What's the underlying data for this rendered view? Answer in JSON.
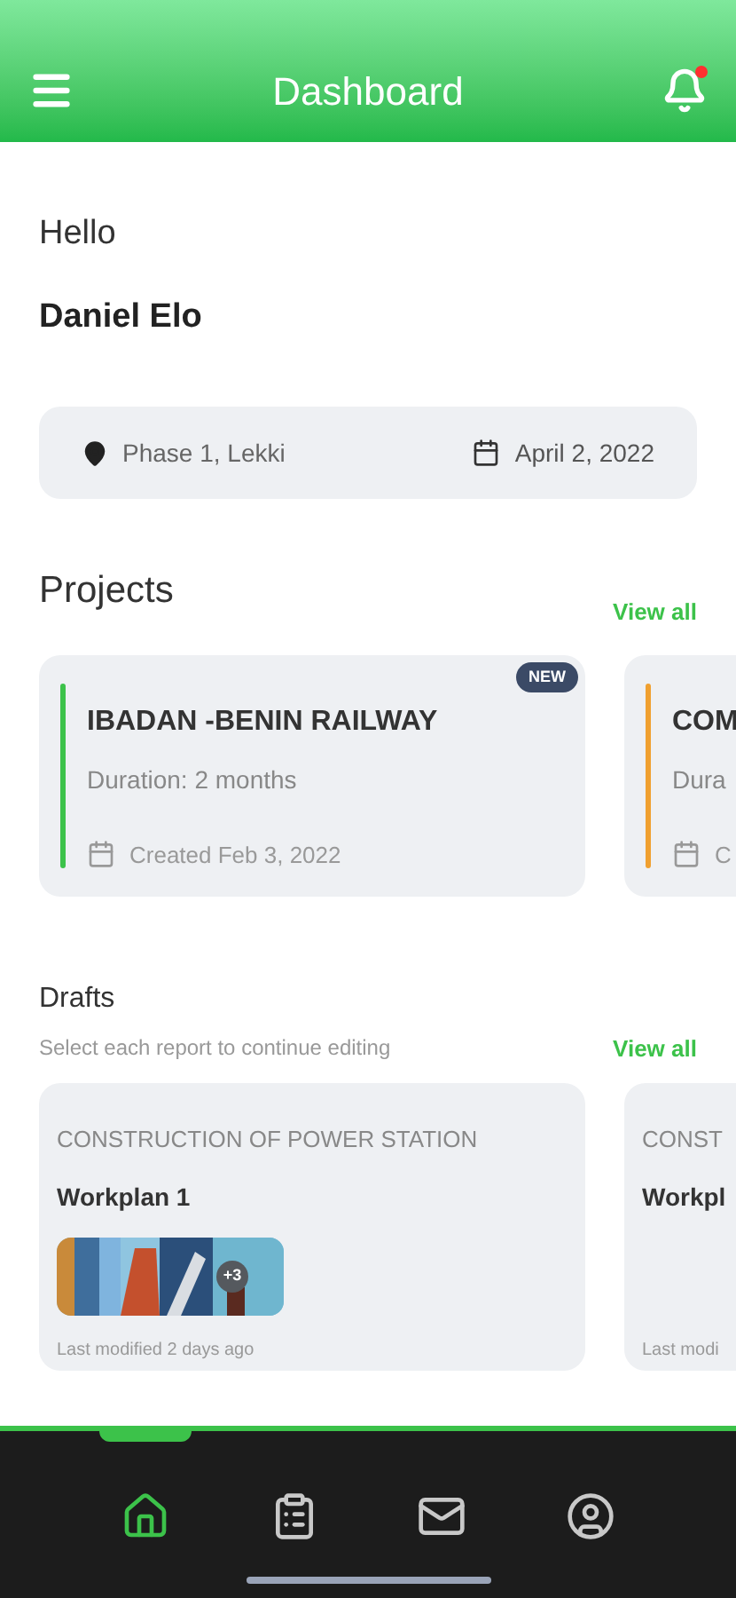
{
  "header": {
    "title": "Dashboard",
    "notification": true
  },
  "greeting": {
    "hello": "Hello",
    "name": "Daniel Elo"
  },
  "info": {
    "location": "Phase 1, Lekki",
    "date": "April 2, 2022"
  },
  "projects": {
    "title": "Projects",
    "view_all": "View all",
    "items": [
      {
        "title": "IBADAN -BENIN RAILWAY",
        "duration": "Duration: 2 months",
        "created": "Created Feb 3, 2022",
        "badge": "NEW",
        "color": "#3cc24a",
        "partial": false
      },
      {
        "title": "COM",
        "duration": "Dura",
        "created": "C",
        "color": "#f0a030",
        "partial": true
      }
    ]
  },
  "drafts": {
    "title": "Drafts",
    "subtitle": "Select each report to continue editing",
    "view_all": "View all",
    "items": [
      {
        "project": "CONSTRUCTION OF POWER STATION",
        "name": "Workplan 1",
        "more": "+3",
        "modified": "Last modified 2 days ago",
        "partial": false
      },
      {
        "project": "CONST",
        "name": "Workpl",
        "modified": "Last modi",
        "partial": true
      }
    ]
  },
  "nav": [
    {
      "kind": "home",
      "selected": true
    },
    {
      "kind": "clipboard",
      "selected": false
    },
    {
      "kind": "mail",
      "selected": false
    },
    {
      "kind": "profile",
      "selected": false
    }
  ]
}
